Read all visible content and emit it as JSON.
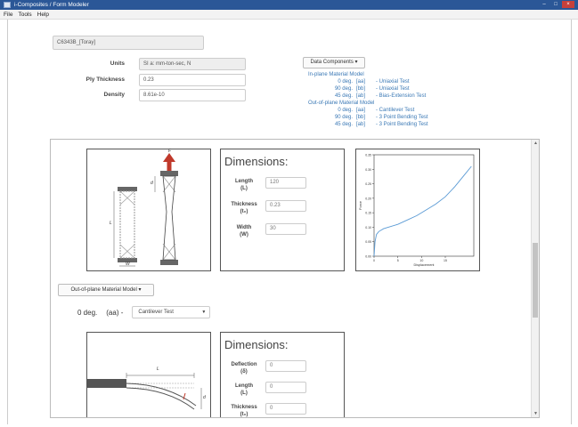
{
  "window": {
    "title": "i-Composites / Form Modeler",
    "buttons": [
      "–",
      "□",
      "×"
    ]
  },
  "menu": [
    "File",
    "Tools",
    "Help"
  ],
  "material": {
    "name": "C6343B_[Toray]",
    "units_label": "Units",
    "units_value": "SI a: mm-ton-sec, N",
    "ply_label": "Ply Thickness",
    "ply_value": "0.23",
    "density_label": "Density",
    "density_value": "8.61e-10"
  },
  "data_components": {
    "button": "Data Components ▾",
    "inplane_header": "In-plane Material Model",
    "inplane": [
      {
        "deg": "0 deg.",
        "code": "[aa]",
        "test": "- Uniaxial Test"
      },
      {
        "deg": "90 deg.",
        "code": "[bb]",
        "test": "- Uniaxial Test"
      },
      {
        "deg": "45 deg.",
        "code": "[ab]",
        "test": "- Bias-Extension Test"
      }
    ],
    "outplane_header": "Out-of-plane Material Model",
    "outplane": [
      {
        "deg": "0 deg.",
        "code": "[aa]",
        "test": "- Cantilever Test"
      },
      {
        "deg": "90 deg.",
        "code": "[bb]",
        "test": "- 3 Point Bending Test"
      },
      {
        "deg": "45 deg.",
        "code": "[ab]",
        "test": "- 3 Point Bending Test"
      }
    ]
  },
  "dims1": {
    "title": "Dimensions:",
    "length_label": "Length",
    "length_sym": "(L)",
    "length_value": "120",
    "thick_label": "Thickness",
    "thick_sym": "(t₀)",
    "thick_value": "0.23",
    "width_label": "Width",
    "width_sym": "(W)",
    "width_value": "30"
  },
  "diagram1": {
    "f_label": "F",
    "d_label": "d",
    "l_label": "L",
    "w_label": "W"
  },
  "chart": {
    "yticks": [
      "0.35",
      "0.30",
      "0.25",
      "0.20",
      "0.15",
      "0.10",
      "0.05",
      "0.00"
    ],
    "xticks": [
      "0",
      "5",
      "10",
      "15"
    ],
    "xlabel": "Displacement",
    "ylabel": "Force",
    "curve_color": "#5b9bd5"
  },
  "chart_data": {
    "type": "line",
    "title": "",
    "xlabel": "Displacement",
    "ylabel": "Force",
    "xlim": [
      0,
      21
    ],
    "ylim": [
      0,
      0.35
    ],
    "series": [
      {
        "x": [
          0,
          0.2,
          0.5,
          1,
          2,
          3,
          5,
          7,
          9,
          11,
          13,
          15,
          17,
          19,
          20.5
        ],
        "y": [
          0,
          0.05,
          0.075,
          0.085,
          0.095,
          0.1,
          0.11,
          0.125,
          0.14,
          0.16,
          0.18,
          0.205,
          0.24,
          0.28,
          0.31
        ]
      }
    ]
  },
  "outofplane": {
    "button": "Out-of-plane Material Model ▾",
    "deg": "0 deg.",
    "code": "(aa) -",
    "select_value": "Cantilever Test"
  },
  "dims2": {
    "title": "Dimensions:",
    "defl_label": "Deflection",
    "defl_sym": "(δ)",
    "defl_value": "0",
    "length_label": "Length",
    "length_sym": "(L)",
    "length_value": "0",
    "thick_label": "Thickness",
    "thick_sym": "(t₀)",
    "thick_value": "0"
  },
  "diagram2": {
    "l_label": "L",
    "d_label": "d"
  }
}
